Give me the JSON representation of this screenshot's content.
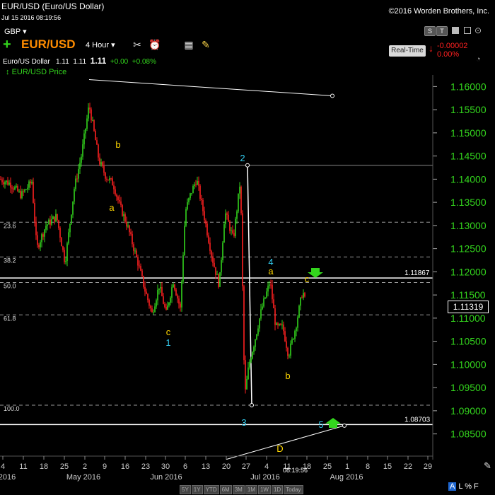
{
  "header": {
    "title": "EUR/USD (Euro/US Dollar)",
    "datetime": "Jul 15 2016 08:19:56",
    "copyright": "©2016 Worden Brothers, Inc.",
    "currency": "GBP ▾"
  },
  "window_buttons": [
    "S",
    "T",
    "",
    "",
    ""
  ],
  "toolbar": {
    "add_icon": "plus-icon",
    "symbol": "EUR/USD",
    "interval": "4 Hour",
    "tools": [
      "wrench-icon",
      "alarm-clock-icon",
      "calculator-icon",
      "note-icon"
    ],
    "realtime_label": "Real-Time",
    "change": "-0.00002",
    "change_pct": "0.00%"
  },
  "ticker": {
    "name": "Euro/US Dollar",
    "open": "1.11",
    "high": "1.11",
    "last": "1.11",
    "change": "+0.00",
    "change_pct": "+0.08%"
  },
  "legend": "EUR/USD Price",
  "price_box": "1.11319",
  "time_label": "08:19:56",
  "bottom_tabs": [
    "5Y",
    "1Y",
    "YTD",
    "6M",
    "3M",
    "1M",
    "1W",
    "1D",
    "Today"
  ],
  "bottom_right": [
    "A",
    "L",
    "%",
    "F"
  ],
  "chart_data": {
    "type": "line",
    "y_ticks": [
      "1.16000",
      "1.15500",
      "1.15000",
      "1.14500",
      "1.14000",
      "1.13500",
      "1.13000",
      "1.12500",
      "1.12000",
      "1.11500",
      "1.11000",
      "1.10500",
      "1.10000",
      "1.09500",
      "1.09000",
      "1.08500"
    ],
    "ylim": [
      1.0825,
      1.1625
    ],
    "x_ticks": [
      "4",
      "11",
      "18",
      "25",
      "2",
      "9",
      "16",
      "23",
      "30",
      "6",
      "13",
      "20",
      "27",
      "4",
      "11",
      "18",
      "25",
      "1",
      "8",
      "15",
      "22",
      "29"
    ],
    "month_labels": [
      "2016",
      "May 2016",
      "Jun 2016",
      "Jul 2016",
      "Aug 2016"
    ],
    "fib_levels": [
      {
        "label": "23.6",
        "value": 1.1307
      },
      {
        "label": "38.2",
        "value": 1.1232
      },
      {
        "label": "50.0",
        "value": 1.1177
      },
      {
        "label": "61.8",
        "value": 1.1107
      },
      {
        "label": "100.0",
        "value": 1.0912
      }
    ],
    "horizontal_lines": [
      {
        "label": "1.11867",
        "value": 1.11867
      },
      {
        "label": "1.08703",
        "value": 1.08703
      }
    ],
    "wave_labels": [
      {
        "text": "b",
        "color": "#ffd700"
      },
      {
        "text": "a",
        "color": "#ffd700"
      },
      {
        "text": "c",
        "color": "#ffd700"
      },
      {
        "text": "1",
        "color": "#33ccee"
      },
      {
        "text": "2",
        "color": "#33ccee"
      },
      {
        "text": "3",
        "color": "#33ccee"
      },
      {
        "text": "4",
        "color": "#33ccee"
      },
      {
        "text": "a",
        "color": "#ffd700"
      },
      {
        "text": "c",
        "color": "#ffd700"
      },
      {
        "text": "b",
        "color": "#ffd700"
      },
      {
        "text": "5",
        "color": "#33ccee"
      },
      {
        "text": "D",
        "color": "#ffd700"
      }
    ],
    "candle_color_up": "#33d51d",
    "candle_color_down": "#ff2020"
  }
}
